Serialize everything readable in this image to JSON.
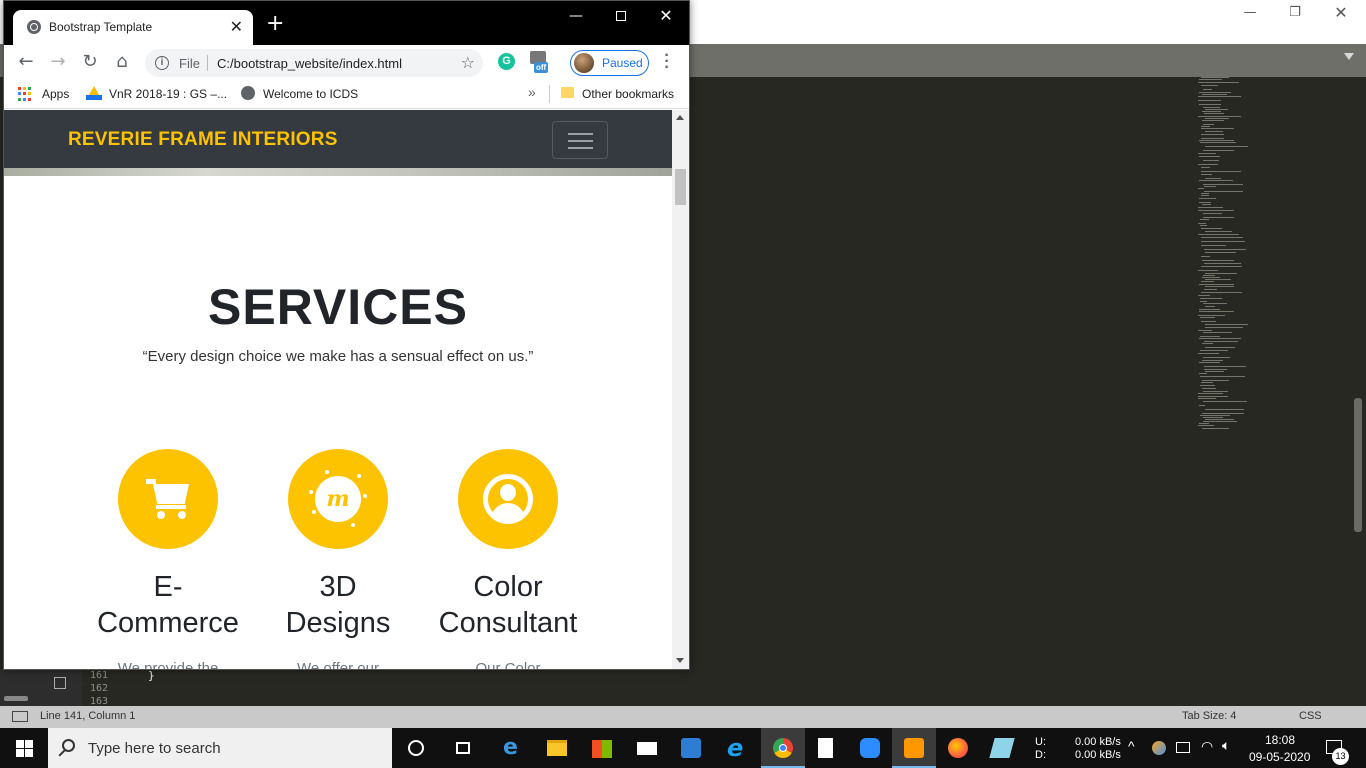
{
  "editor": {
    "status_position": "Line 141, Column 1",
    "status_tab_size": "Tab Size: 4",
    "status_syntax": "CSS",
    "gutter_lines": [
      "161",
      "162",
      "163"
    ],
    "code_brace": "}"
  },
  "browser": {
    "tab_title": "Bootstrap Template",
    "new_tab": "+",
    "address_scheme": "File",
    "address_url": "C:/bootstrap_website/index.html",
    "profile_status": "Paused",
    "extension_off_label": "off",
    "extension_g_label": "G",
    "bookmarks": [
      {
        "label": "Apps"
      },
      {
        "label": "VnR 2018-19 : GS –..."
      },
      {
        "label": "Welcome to ICDS"
      }
    ],
    "bookmarks_overflow": "»",
    "other_bookmarks": "Other bookmarks"
  },
  "site": {
    "brand": "REVERIE FRAME INTERIORS",
    "services_title": "SERVICES",
    "services_quote": "“Every design choice we make has a sensual effect on us.”",
    "services": [
      {
        "icon": "shopping-cart-icon",
        "title": "E-\nCommerce",
        "desc": "We provide the"
      },
      {
        "icon": "meetup-icon",
        "title": "3D\nDesigns",
        "desc": "We offer our"
      },
      {
        "icon": "user-circle-icon",
        "title": "Color\nConsultant",
        "desc": "Our Color"
      }
    ],
    "accent_color": "#fdc200",
    "nav_color": "#343a40"
  },
  "taskbar": {
    "search_placeholder": "Type here to search",
    "net_upload_label": "U:",
    "net_download_label": "D:",
    "net_upload": "0.00 kB/s",
    "net_download": "0.00 kB/s",
    "time": "18:08",
    "date": "09-05-2020",
    "notification_count": "13"
  }
}
